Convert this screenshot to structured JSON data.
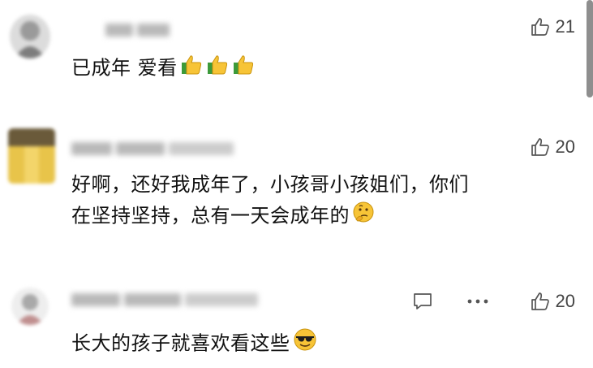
{
  "comments": [
    {
      "text": "已成年 爱看",
      "emoji": [
        "thumbs-up-emoji",
        "thumbs-up-emoji",
        "thumbs-up-emoji"
      ],
      "likes": "21"
    },
    {
      "text_line1": "好啊，还好我成年了，小孩哥小孩姐们，你们",
      "text_line2": "在坚持坚持，总有一天会成年的",
      "emoji": [
        "thinking-face-emoji"
      ],
      "likes": "20"
    },
    {
      "text": "长大的孩子就喜欢看这些",
      "emoji": [
        "sunglasses-face-emoji"
      ],
      "likes": "20"
    }
  ],
  "icons": {
    "like": "thumbs-up-outline-icon",
    "reply": "comment-icon",
    "more": "more-dots-icon"
  },
  "colors": {
    "text": "#111111",
    "icon": "#555555",
    "emoji_yellow": "#f7c437",
    "emoji_green": "#3c9a3a"
  }
}
